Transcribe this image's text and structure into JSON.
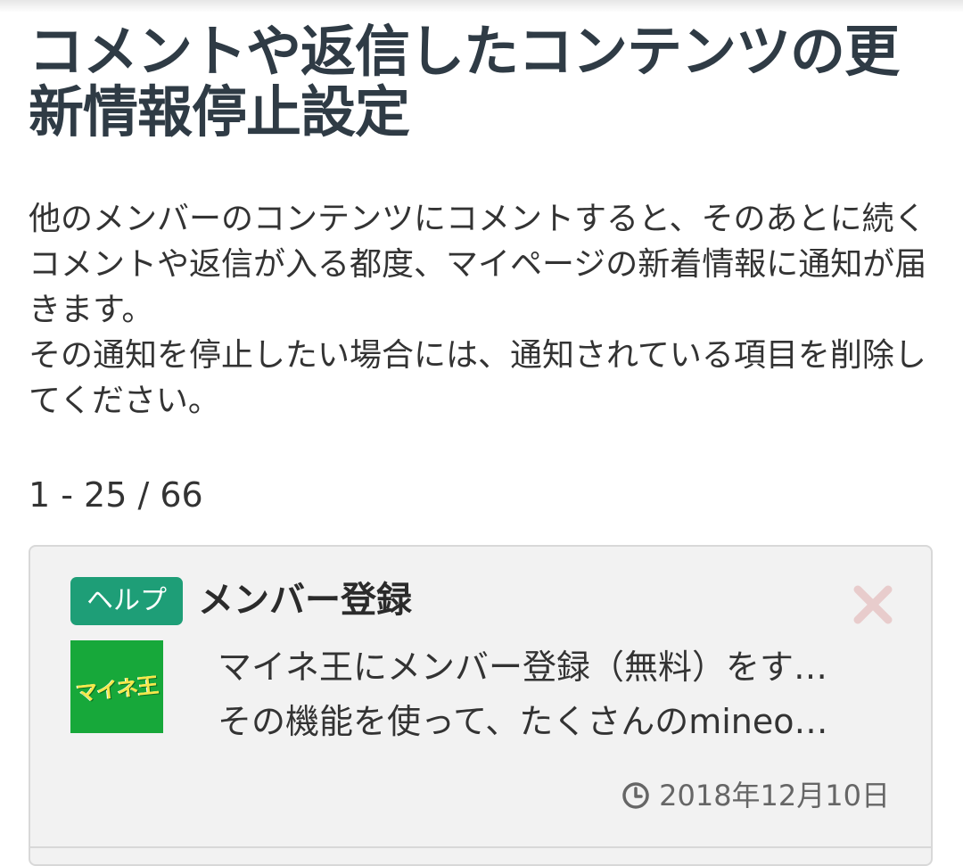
{
  "page": {
    "title": "コメントや返信したコンテンツの更新情報停止設定",
    "description": "他のメンバーのコンテンツにコメントすると、そのあとに続くコメントや返信が入る都度、マイページの新着情報に通知が届きます。\nその通知を停止したい場合には、通知されている項目を削除してください。",
    "pagination": "1 - 25 / 66"
  },
  "items": [
    {
      "badge": "ヘルプ",
      "title": "メンバー登録",
      "thumbnail_text": "マイネ王",
      "excerpt_line1": "マイネ王にメンバー登録（無料）をす…",
      "excerpt_line2": "その機能を使って、たくさんのmineo…",
      "date": "2018年12月10日",
      "delete_icon": "close-icon",
      "date_icon": "clock-icon"
    }
  ],
  "colors": {
    "title": "#2f3b45",
    "badge_bg": "#1e9e77",
    "card_bg": "#f2f2f2",
    "delete_icon": "#e8cccc",
    "thumb_bg": "#17a83a"
  }
}
